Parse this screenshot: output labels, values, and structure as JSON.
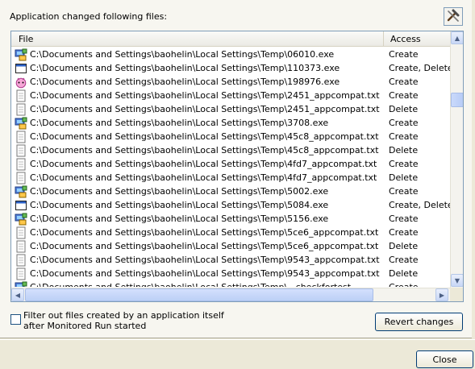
{
  "header": {
    "text": "Application changed following files:"
  },
  "toolbar": {
    "tool_icon": "hammer-icon"
  },
  "table": {
    "columns": [
      "File",
      "Access"
    ],
    "rows": [
      {
        "icon": "exe-app-icon",
        "file": "C:\\Documents and Settings\\baohelin\\Local Settings\\Temp\\06010.exe",
        "access": "Create"
      },
      {
        "icon": "window-icon",
        "file": "C:\\Documents and Settings\\baohelin\\Local Settings\\Temp\\110373.exe",
        "access": "Create, Delete"
      },
      {
        "icon": "pink-app-icon",
        "file": "C:\\Documents and Settings\\baohelin\\Local Settings\\Temp\\198976.exe",
        "access": "Create"
      },
      {
        "icon": "text-file-icon",
        "file": "C:\\Documents and Settings\\baohelin\\Local Settings\\Temp\\2451_appcompat.txt",
        "access": "Create"
      },
      {
        "icon": "text-file-icon",
        "file": "C:\\Documents and Settings\\baohelin\\Local Settings\\Temp\\2451_appcompat.txt",
        "access": "Delete"
      },
      {
        "icon": "exe-app-icon",
        "file": "C:\\Documents and Settings\\baohelin\\Local Settings\\Temp\\3708.exe",
        "access": "Create"
      },
      {
        "icon": "text-file-icon",
        "file": "C:\\Documents and Settings\\baohelin\\Local Settings\\Temp\\45c8_appcompat.txt",
        "access": "Create"
      },
      {
        "icon": "text-file-icon",
        "file": "C:\\Documents and Settings\\baohelin\\Local Settings\\Temp\\45c8_appcompat.txt",
        "access": "Delete"
      },
      {
        "icon": "text-file-icon",
        "file": "C:\\Documents and Settings\\baohelin\\Local Settings\\Temp\\4fd7_appcompat.txt",
        "access": "Create"
      },
      {
        "icon": "text-file-icon",
        "file": "C:\\Documents and Settings\\baohelin\\Local Settings\\Temp\\4fd7_appcompat.txt",
        "access": "Delete"
      },
      {
        "icon": "exe-app-icon",
        "file": "C:\\Documents and Settings\\baohelin\\Local Settings\\Temp\\5002.exe",
        "access": "Create"
      },
      {
        "icon": "window-icon",
        "file": "C:\\Documents and Settings\\baohelin\\Local Settings\\Temp\\5084.exe",
        "access": "Create, Delete"
      },
      {
        "icon": "exe-app-icon",
        "file": "C:\\Documents and Settings\\baohelin\\Local Settings\\Temp\\5156.exe",
        "access": "Create"
      },
      {
        "icon": "text-file-icon",
        "file": "C:\\Documents and Settings\\baohelin\\Local Settings\\Temp\\5ce6_appcompat.txt",
        "access": "Create"
      },
      {
        "icon": "text-file-icon",
        "file": "C:\\Documents and Settings\\baohelin\\Local Settings\\Temp\\5ce6_appcompat.txt",
        "access": "Delete"
      },
      {
        "icon": "text-file-icon",
        "file": "C:\\Documents and Settings\\baohelin\\Local Settings\\Temp\\9543_appcompat.txt",
        "access": "Create"
      },
      {
        "icon": "text-file-icon",
        "file": "C:\\Documents and Settings\\baohelin\\Local Settings\\Temp\\9543_appcompat.txt",
        "access": "Delete"
      },
      {
        "icon": "exe-app-icon",
        "file": "C:\\Documents and Settings\\baohelin\\Local Settings\\Temp\\...checkfortest",
        "access": "Create"
      }
    ]
  },
  "filter": {
    "label": "Filter out files created by an application itself after Monitored Run started",
    "checked": false
  },
  "buttons": {
    "revert": "Revert changes",
    "close": "Close"
  }
}
